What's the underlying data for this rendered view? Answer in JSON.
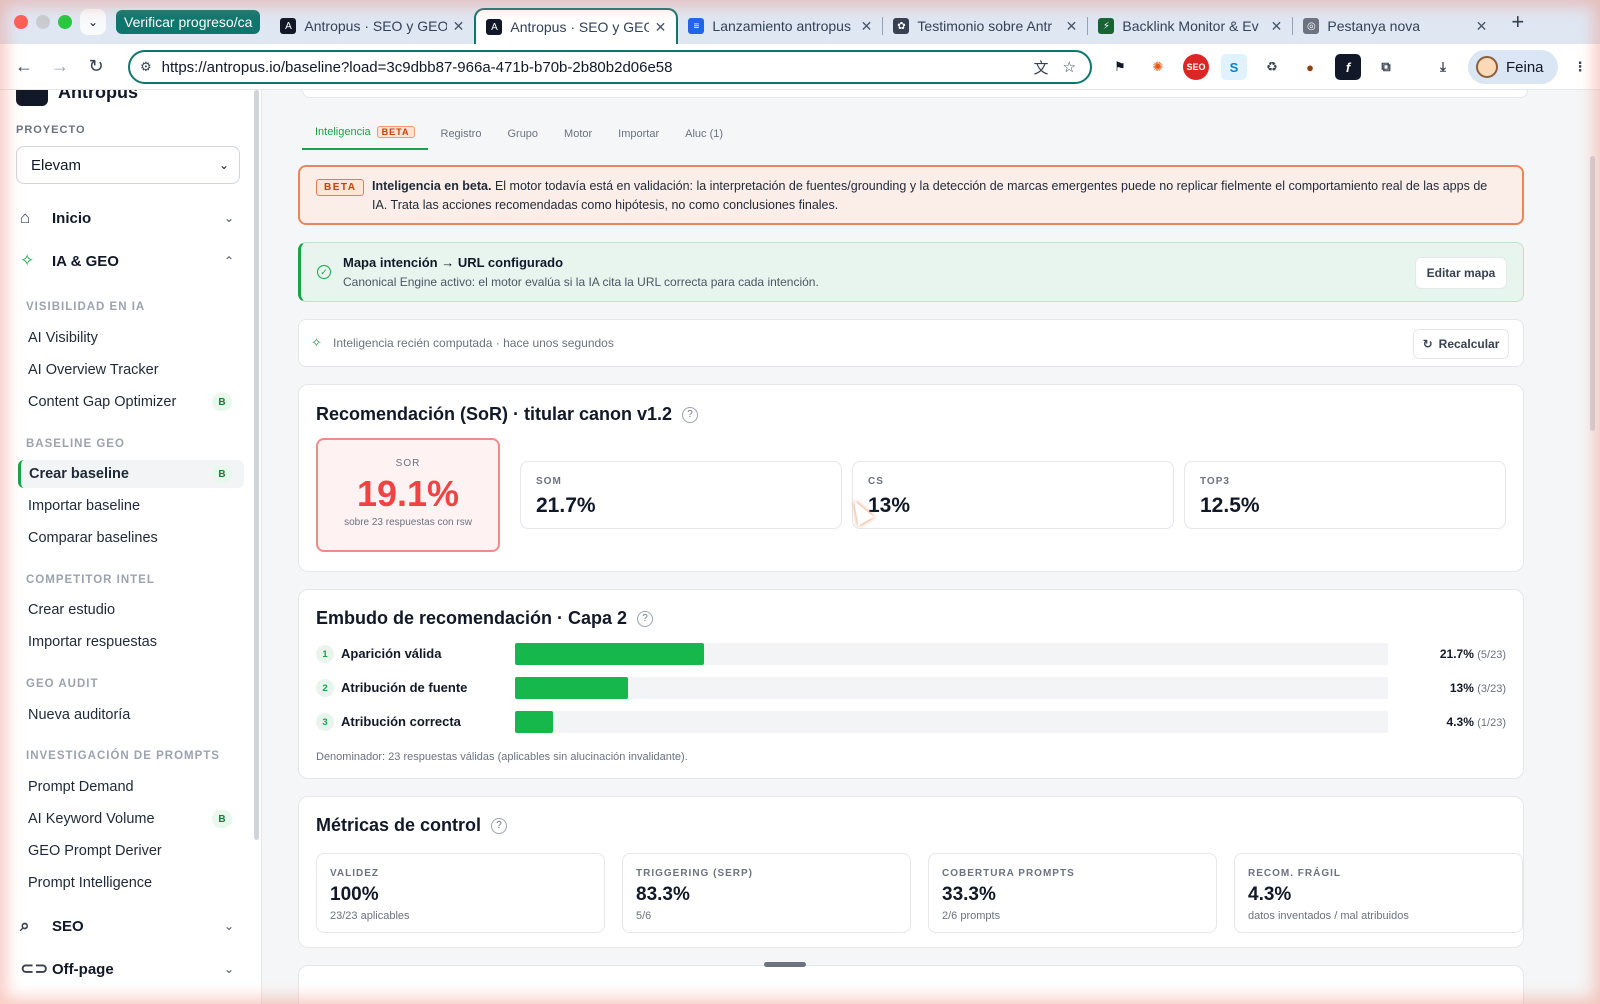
{
  "browser": {
    "tab_group_label": "Verificar progreso/ca",
    "tabs": [
      {
        "title": "Antropus · SEO y GEO",
        "active": false
      },
      {
        "title": "Antropus · SEO y GEO",
        "active": true
      },
      {
        "title": "Lanzamiento antropus",
        "active": false
      },
      {
        "title": "Testimonio sobre Antr",
        "active": false
      },
      {
        "title": "Backlink Monitor & Ev",
        "active": false
      },
      {
        "title": "Pestanya nova",
        "active": false
      }
    ],
    "url": "https://antropus.io/baseline?load=3c9dbb87-966a-471b-b70b-2b80b2d06e58",
    "profile_label": "Feina"
  },
  "sidebar": {
    "brand": "Antropus",
    "project_label": "PROYECTO",
    "project_value": "Elevam",
    "nav": {
      "inicio": "Inicio",
      "ia_geo": "IA & GEO",
      "seo": "SEO",
      "offpage": "Off-page"
    },
    "sections": [
      {
        "heading": "VISIBILIDAD EN IA",
        "items": [
          {
            "label": "AI Visibility",
            "badge": ""
          },
          {
            "label": "AI Overview Tracker",
            "badge": ""
          },
          {
            "label": "Content Gap Optimizer",
            "badge": "B"
          }
        ]
      },
      {
        "heading": "BASELINE GEO",
        "items": [
          {
            "label": "Crear baseline",
            "badge": "B"
          },
          {
            "label": "Importar baseline",
            "badge": ""
          },
          {
            "label": "Comparar baselines",
            "badge": ""
          }
        ]
      },
      {
        "heading": "COMPETITOR INTEL",
        "items": [
          {
            "label": "Crear estudio",
            "badge": ""
          },
          {
            "label": "Importar respuestas",
            "badge": ""
          }
        ]
      },
      {
        "heading": "GEO AUDIT",
        "items": [
          {
            "label": "Nueva auditoría",
            "badge": ""
          }
        ]
      },
      {
        "heading": "INVESTIGACIÓN DE PROMPTS",
        "items": [
          {
            "label": "Prompt Demand",
            "badge": ""
          },
          {
            "label": "AI Keyword Volume",
            "badge": "B"
          },
          {
            "label": "GEO Prompt Deriver",
            "badge": ""
          },
          {
            "label": "Prompt Intelligence",
            "badge": ""
          }
        ]
      }
    ]
  },
  "main": {
    "tabs": [
      {
        "label": "Inteligencia",
        "badge": "BETA",
        "active": true
      },
      {
        "label": "Registro"
      },
      {
        "label": "Grupo"
      },
      {
        "label": "Motor"
      },
      {
        "label": "Importar"
      },
      {
        "label": "Aluc (1)"
      }
    ],
    "beta_notice": {
      "tag": "BETA",
      "title": "Inteligencia en beta.",
      "text": "El motor todavía está en validación: la interpretación de fuentes/grounding y la detección de marcas emergentes puede no replicar fielmente el comportamiento real de las apps de IA. Trata las acciones recomendadas como hipótesis, no como conclusiones finales."
    },
    "map_notice": {
      "title": "Mapa intención → URL configurado",
      "subtitle": "Canonical Engine activo: el motor evalúa si la IA cita la URL correcta para cada intención.",
      "button": "Editar mapa"
    },
    "recompute": {
      "text": "Inteligencia recién computada · hace unos segundos",
      "button": "Recalcular"
    },
    "sor_card": {
      "title": "Recomendación (SoR) · titular canon v1.2",
      "primary": {
        "label": "SOR",
        "value": "19.1%",
        "sub": "sobre 23 respuestas con rsw"
      },
      "metrics": [
        {
          "label": "SOM",
          "value": "21.7%"
        },
        {
          "label": "CS",
          "value": "13%"
        },
        {
          "label": "TOP3",
          "value": "12.5%"
        }
      ]
    },
    "funnel": {
      "title": "Embudo de recomendación · Capa 2",
      "rows": [
        {
          "n": "1",
          "label": "Aparición válida",
          "pct": "21.7%",
          "frac": "(5/23)",
          "value": 0.217
        },
        {
          "n": "2",
          "label": "Atribución de fuente",
          "pct": "13%",
          "frac": "(3/23)",
          "value": 0.13
        },
        {
          "n": "3",
          "label": "Atribución correcta",
          "pct": "4.3%",
          "frac": "(1/23)",
          "value": 0.043
        }
      ],
      "denominator": "Denominador: 23 respuestas válidas (aplicables sin alucinación invalidante)."
    },
    "control": {
      "title": "Métricas de control",
      "metrics": [
        {
          "label": "VALIDEZ",
          "value": "100%",
          "sub": "23/23 aplicables"
        },
        {
          "label": "TRIGGERING (SERP)",
          "value": "83.3%",
          "sub": "5/6"
        },
        {
          "label": "COBERTURA PROMPTS",
          "value": "33.3%",
          "sub": "2/6 prompts"
        },
        {
          "label": "RECOM. FRÁGIL",
          "value": "4.3%",
          "sub": "datos inventados / mal atribuidos"
        }
      ]
    }
  },
  "colors": {
    "accent": "#16a34a",
    "beta": "#ea8659",
    "sor": "#ef4444",
    "bar": "#16b84c"
  }
}
